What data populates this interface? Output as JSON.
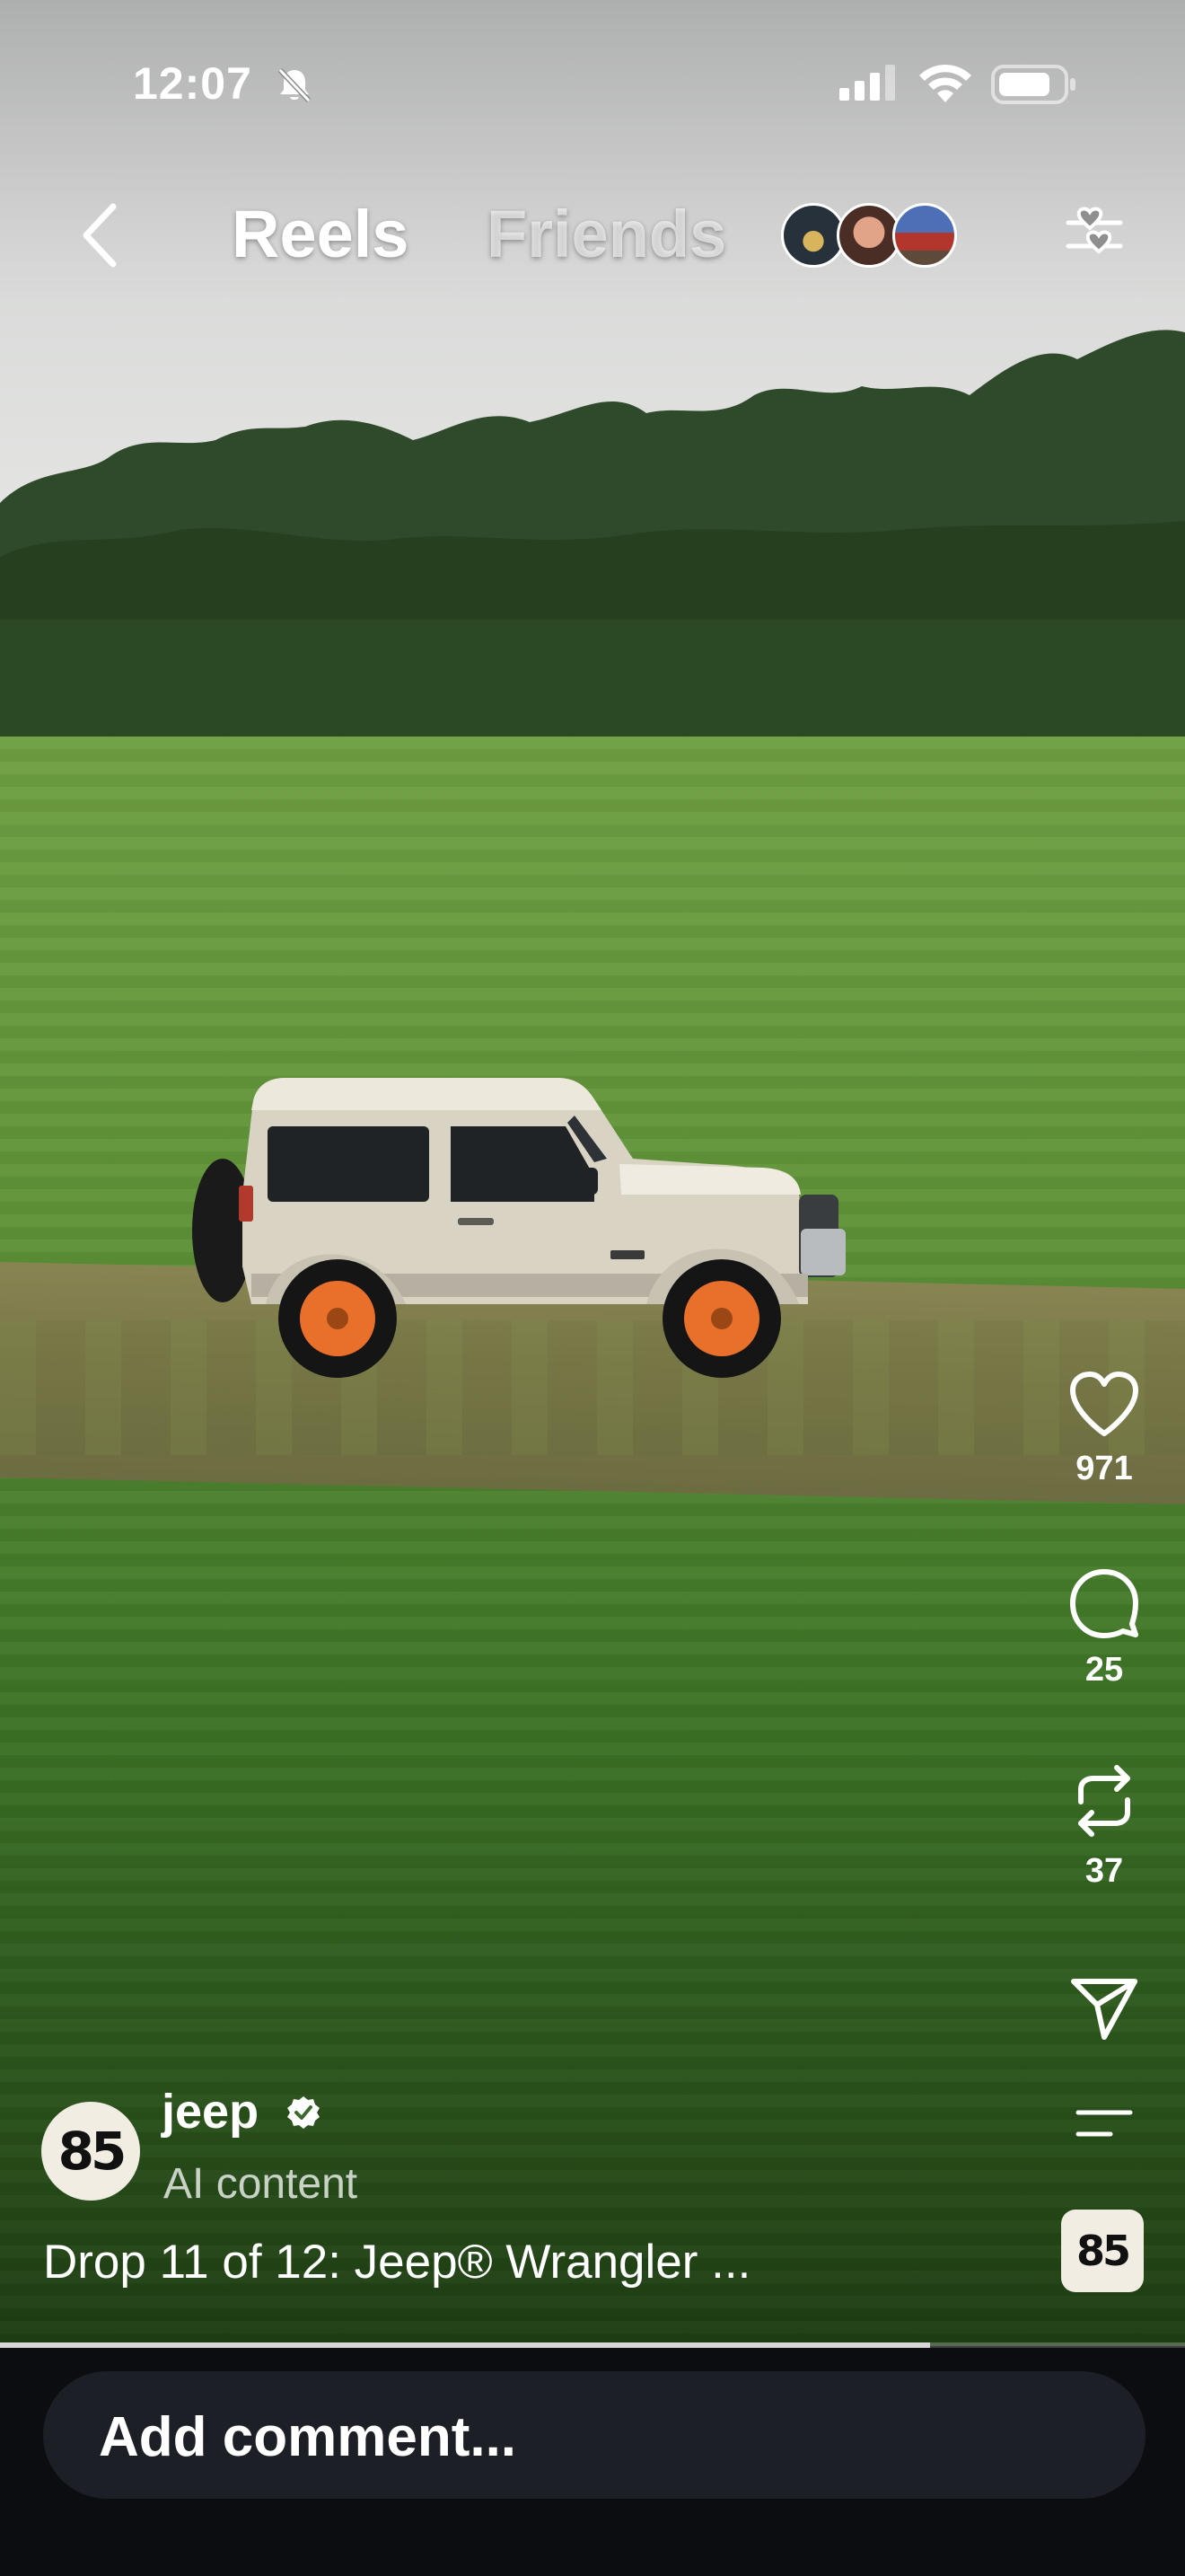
{
  "status_bar": {
    "time": "12:07",
    "icons": [
      "bell-slash-icon",
      "signal-icon",
      "wifi-icon",
      "battery-icon"
    ]
  },
  "header": {
    "back_icon": "chevron-left-icon",
    "tabs": [
      {
        "label": "Reels",
        "active": true
      },
      {
        "label": "Friends",
        "active": false
      }
    ],
    "filter_icon": "sliders-heart-icon"
  },
  "reel": {
    "description": "video-frame",
    "actions": {
      "like": {
        "icon": "heart-icon",
        "count": "971"
      },
      "comment": {
        "icon": "comment-bubble-icon",
        "count": "25"
      },
      "repost": {
        "icon": "repost-icon",
        "count": "37"
      },
      "share": {
        "icon": "paper-plane-icon"
      },
      "more": {
        "icon": "menu-lines-icon"
      }
    },
    "author": {
      "username": "jeep",
      "verified": true,
      "label": "AI content",
      "avatar_text": "85"
    },
    "caption": "Drop 11 of 12: Jeep® Wrangler ...",
    "audio_thumb_text": "85",
    "progress": 0.785
  },
  "comment_bar": {
    "placeholder": "Add comment..."
  },
  "colors": {
    "accent_orange": "#e8702a",
    "comment_bg": "#0b0d11"
  }
}
